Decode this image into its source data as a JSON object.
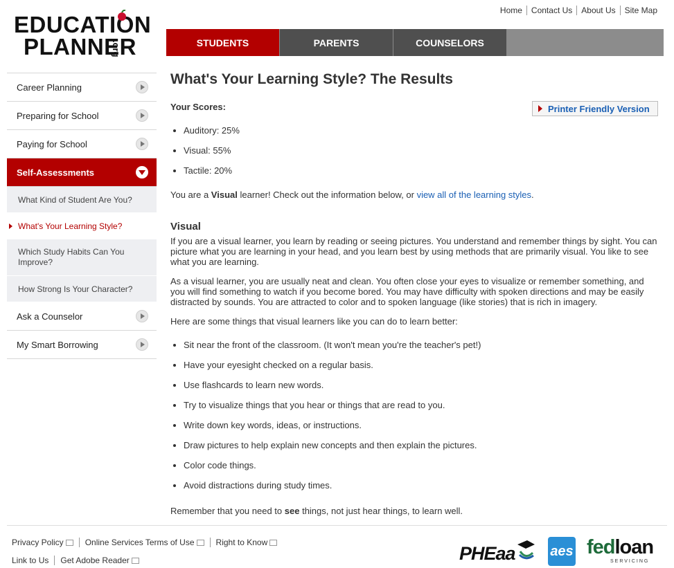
{
  "logo": {
    "line1": "EDUCATION",
    "line2": "PLANNER",
    "suffix": ".org"
  },
  "top_links": [
    "Home",
    "Contact Us",
    "About Us",
    "Site Map"
  ],
  "main_nav": [
    {
      "label": "STUDENTS",
      "active": true
    },
    {
      "label": "PARENTS",
      "active": false
    },
    {
      "label": "COUNSELORS",
      "active": false
    }
  ],
  "sidebar": {
    "items": [
      {
        "label": "Career Planning"
      },
      {
        "label": "Preparing for School"
      },
      {
        "label": "Paying for School"
      },
      {
        "label": "Self-Assessments"
      }
    ],
    "sub_items": [
      {
        "label": "What Kind of Student Are You?"
      },
      {
        "label": "What's Your Learning Style?"
      },
      {
        "label": "Which Study Habits Can You Improve?"
      },
      {
        "label": "How Strong Is Your Character?"
      }
    ],
    "bottom_items": [
      {
        "label": "Ask a Counselor"
      },
      {
        "label": "My Smart Borrowing"
      }
    ]
  },
  "content": {
    "title": "What's Your Learning Style? The Results",
    "scores_label": "Your Scores:",
    "printer_label": "Printer Friendly Version",
    "scores": [
      "Auditory: 25%",
      "Visual: 55%",
      "Tactile: 20%"
    ],
    "learner_prefix": "You are a ",
    "learner_bold": "Visual",
    "learner_mid": " learner! Check out the information below, or ",
    "learner_link": "view all of the learning styles",
    "learner_end": ".",
    "section_title": "Visual",
    "para1": "If you are a visual learner, you learn by reading or seeing pictures. You understand and remember things by sight. You can picture what you are learning in your head, and you learn best by using methods that are primarily visual. You like to see what you are learning.",
    "para2": "As a visual learner, you are usually neat and clean. You often close your eyes to visualize or remember something, and you will find something to watch if you become bored. You may have difficulty with spoken directions and may be easily distracted by sounds. You are attracted to color and to spoken language (like stories) that is rich in imagery.",
    "para3": "Here are some things that visual learners like you can do to learn better:",
    "tips": [
      "Sit near the front of the classroom. (It won't mean you're the teacher's pet!)",
      "Have your eyesight checked on a regular basis.",
      "Use flashcards to learn new words.",
      "Try to visualize things that you hear or things that are read to you.",
      "Write down key words, ideas, or instructions.",
      "Draw pictures to help explain new concepts and then explain the pictures.",
      "Color code things.",
      "Avoid distractions during study times."
    ],
    "closing_prefix": "Remember that you need to ",
    "closing_bold": "see",
    "closing_end": " things, not just hear things, to learn well."
  },
  "footer": {
    "row1": [
      "Privacy Policy",
      "Online Services Terms of Use",
      "Right to Know"
    ],
    "row2": [
      "Link to Us",
      "Get Adobe Reader"
    ],
    "logos": {
      "pheaa": "PHEaa",
      "aes": "aes",
      "fed": "fed",
      "loan": "loan",
      "servicing": "SERVICING"
    }
  },
  "colors": {
    "brand_red": "#b30000",
    "link_blue": "#1a5fb4",
    "nav_gray": "#4f4f4f"
  }
}
